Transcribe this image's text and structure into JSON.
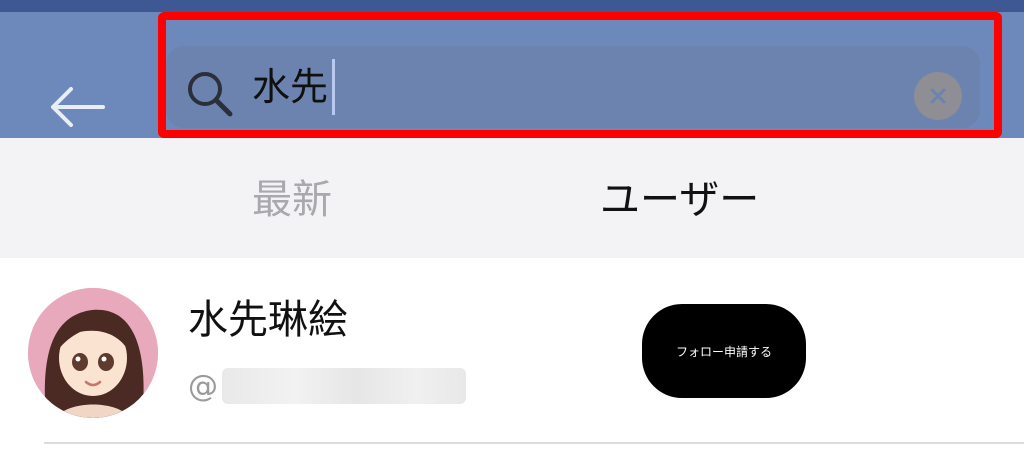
{
  "header": {
    "back_icon": "arrow-left-icon",
    "search": {
      "icon": "search-icon",
      "query": "水先",
      "clear_icon": "clear-circle-icon"
    }
  },
  "tabs": [
    {
      "label": "最新",
      "active": false
    },
    {
      "label": "ユーザー",
      "active": true
    }
  ],
  "results": [
    {
      "name": "水先琳絵",
      "id_prefix": "@",
      "follow_label": "フォロー申請する"
    }
  ],
  "colors": {
    "header_bg": "#6d88bb",
    "top_strip": "#3d5892",
    "highlight": "#ff0000",
    "button_bg": "#000000"
  }
}
